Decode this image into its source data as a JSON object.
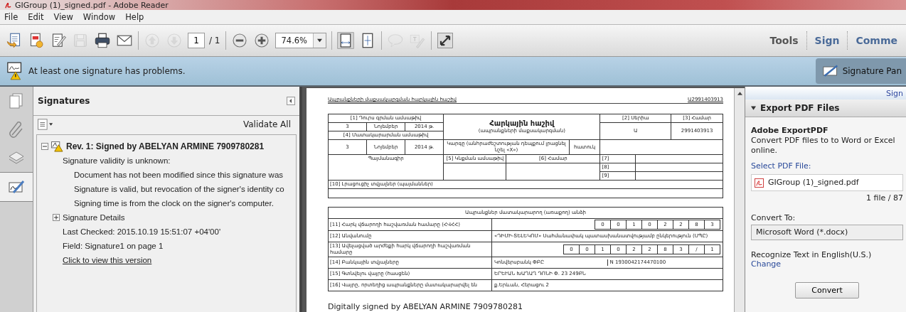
{
  "window": {
    "title": "GIGroup (1)_signed.pdf - Adobe Reader"
  },
  "menu": [
    "File",
    "Edit",
    "View",
    "Window",
    "Help"
  ],
  "toolbar": {
    "buttons": [
      {
        "kind": "open",
        "disabled": false
      },
      {
        "kind": "create",
        "disabled": false
      },
      {
        "kind": "edit",
        "disabled": false
      },
      {
        "kind": "save",
        "disabled": true
      },
      {
        "kind": "print",
        "disabled": false
      },
      {
        "kind": "email",
        "disabled": false
      },
      {
        "kind": "sep"
      },
      {
        "kind": "prev",
        "disabled": true
      },
      {
        "kind": "next",
        "disabled": true
      },
      {
        "kind": "page"
      },
      {
        "kind": "sep"
      },
      {
        "kind": "zoomout",
        "disabled": false
      },
      {
        "kind": "zoomin",
        "disabled": false
      },
      {
        "kind": "zoom"
      },
      {
        "kind": "sep"
      },
      {
        "kind": "fitwidth",
        "disabled": false
      },
      {
        "kind": "fitpage",
        "disabled": false
      },
      {
        "kind": "sep"
      },
      {
        "kind": "comment",
        "disabled": true
      },
      {
        "kind": "highlight",
        "disabled": true
      },
      {
        "kind": "sep"
      },
      {
        "kind": "fullscreen",
        "disabled": false
      }
    ],
    "page_current": "1",
    "page_total": "/ 1",
    "zoom": "74.6%",
    "tabs": [
      {
        "label": "Tools",
        "selected": false
      },
      {
        "label": "Sign",
        "selected": true
      },
      {
        "label": "Comme",
        "selected": true
      }
    ]
  },
  "message_bar": {
    "text": "At least one signature has problems.",
    "button": "Signature Pan"
  },
  "nav_strip": [
    {
      "kind": "pages",
      "selected": false
    },
    {
      "kind": "attachments",
      "selected": false
    },
    {
      "kind": "layers",
      "selected": false
    },
    {
      "kind": "signatures",
      "selected": true
    }
  ],
  "signatures_panel": {
    "title": "Signatures",
    "validate": "Validate All",
    "tree": [
      {
        "label": "Rev. 1: Signed by ABELYAN ARMINE 7909780281",
        "expanded": true,
        "children": [
          {
            "kind": "text",
            "label": "Signature validity is unknown:",
            "children": [
              {
                "label": "Document has not been modified since this signature was"
              },
              {
                "label": "Signature is valid, but revocation of the signer's identity co"
              },
              {
                "label": "Signing time is from the clock on the signer's computer."
              }
            ]
          },
          {
            "kind": "toggle",
            "label": "Signature Details",
            "expanded": false
          },
          {
            "kind": "text",
            "label": "Last Checked: 2015.10.19 15:51:07 +04'00'"
          },
          {
            "kind": "text",
            "label": "Field: Signature1 on page 1"
          },
          {
            "kind": "link",
            "label": "Click to view this version"
          }
        ]
      }
    ]
  },
  "document": {
    "header_left": "Ապրանքների մաքսակարգման հարկային հաշիվ",
    "header_right": "Ա2991403913",
    "top": {
      "issue_date_label": "[1] Դուրս գրման ամսաթիվ",
      "issue_date": [
        "3",
        "Նոյեմբեր",
        "2014 թ."
      ],
      "supply_date_label": "[4] Մատակարարման ամսաթիվ",
      "supply_date": [
        "3",
        "Նոյեմբեր",
        "2014 թ."
      ],
      "title": "Հարկային հաշիվ",
      "subtitle": "(ապրանքների մաքսակարգման)",
      "series_label": "[2] Սերիա",
      "series": "Ա",
      "number_label": "[3] Համար",
      "number": "2991403913",
      "order_label": "Կարգը (անհրաժեշտության դեպքում լրացնել նշել «X»)",
      "special_label": "հատուկ",
      "contract_label": "Պայմանագիր",
      "contract_date_label": "[5] Կնքման ամսաթիվ",
      "contract_number_label": "[6] Համար",
      "extra_labels": [
        "[7]",
        "[8]",
        "[9]"
      ],
      "additional_label": "[10] Լրացուցիչ տվյալներ (պայմաններ)"
    },
    "supplier": {
      "heading": "Ապրանքներ մատակարարող (առաքող) անձի",
      "rows": [
        {
          "kind": "digits",
          "label": "[11] Հարկ վճարողի հաշվառման համարը (ՀՎՀՀ)",
          "digits": [
            "0",
            "0",
            "1",
            "0",
            "2",
            "2",
            "8",
            "3"
          ]
        },
        {
          "kind": "text",
          "label": "[12] Անվանումը",
          "values": [
            "«ԴԻՄԻ-ՏԵԼԵԿՈՄ» Սահմանափակ պատասխանատվությամբ ընկերություն (ՍՊԸ)"
          ]
        },
        {
          "kind": "digits",
          "label": "[13] Ավելացված արժեքի հարկ վճարողի հաշվառման համարը",
          "digits": [
            "0",
            "0",
            "1",
            "0",
            "2",
            "2",
            "8",
            "3",
            "/",
            "1"
          ]
        },
        {
          "kind": "text",
          "label": "[14] Բանկային տվյալները",
          "values": [
            "Կոնվերսբանկ ՓԲԸ",
            "N 1930042174470100"
          ]
        },
        {
          "kind": "text",
          "label": "[15] Գտնվելու վայրը (հասցեն)",
          "values": [
            "ԵՐԵՒԱՆ ԽԱՂԱՂ ԴՈՆԻ Փ. 23 249ԲՆ"
          ]
        },
        {
          "kind": "text",
          "label": "[16] Վայրը, որտեղից ապրանքները մատակարարվել են",
          "values": [
            "ք.Երևան, Հերացու 2"
          ]
        }
      ]
    },
    "signature_stamp": "Digitally signed by ABELYAN ARMINE 7909780281"
  },
  "export_panel": {
    "sign_link": "Sign",
    "section": {
      "title": "Export PDF Files",
      "expanded": true
    },
    "service": "Adobe ExportPDF",
    "description": "Convert PDF files to to Word or Excel online.",
    "select_label": "Select PDF File:",
    "file": "GIGroup (1)_signed.pdf",
    "file_count": "1 file / 87",
    "convert_label": "Convert To:",
    "format": "Microsoft Word (*.docx)",
    "ocr_text": "Recognize Text in English(U.S.)",
    "change_link": "Change",
    "convert_button": "Convert"
  }
}
